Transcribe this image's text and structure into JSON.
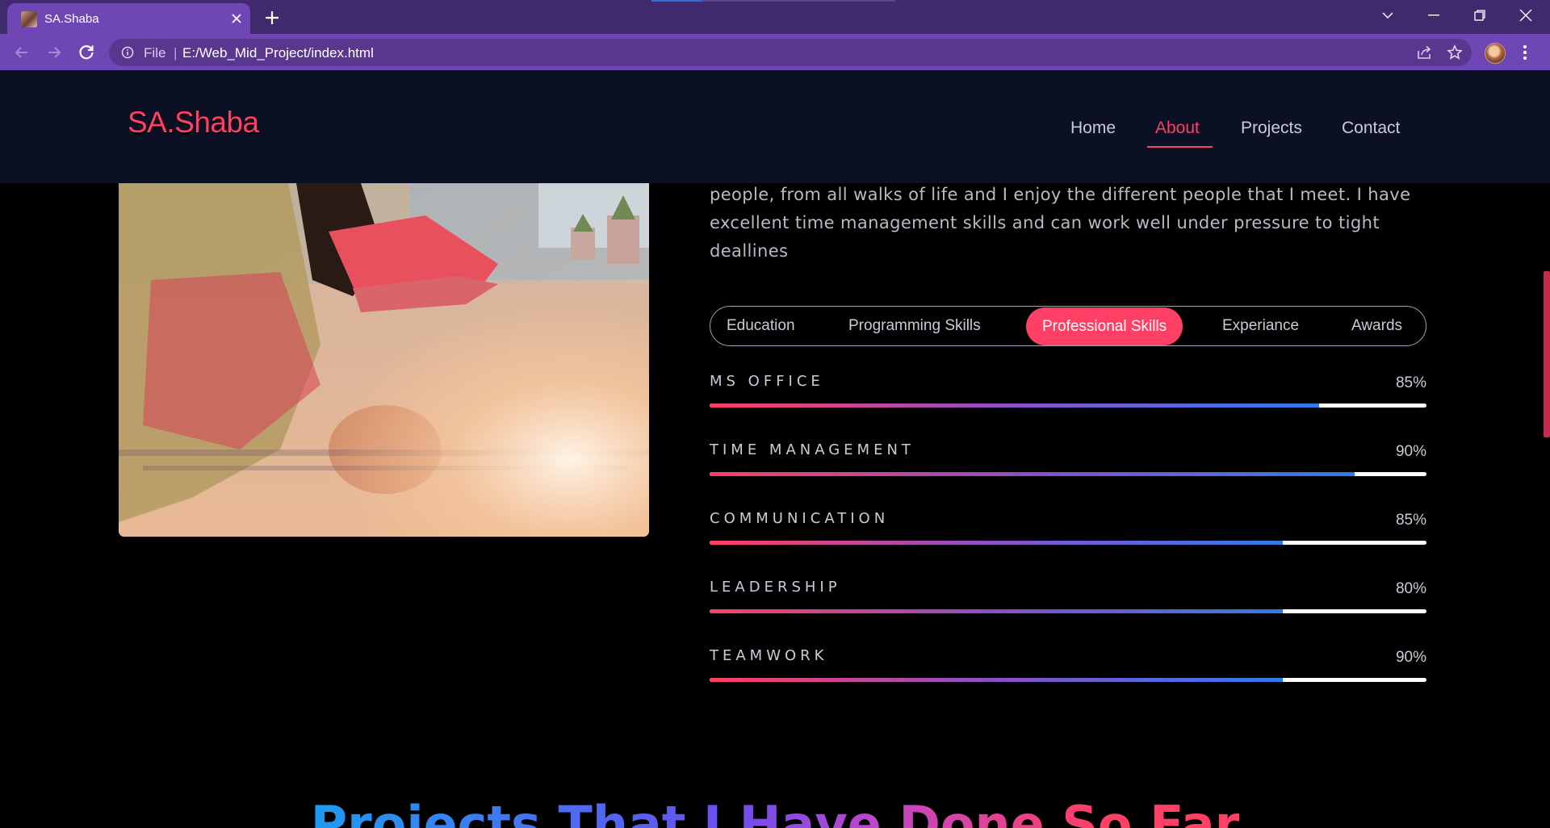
{
  "browser": {
    "tab_title": "SA.Shaba",
    "omnibox_scheme": "File",
    "omnibox_url": "E:/Web_Mid_Project/index.html"
  },
  "site": {
    "logo": "SA.Shaba",
    "nav": [
      {
        "label": "Home"
      },
      {
        "label": "About"
      },
      {
        "label": "Projects"
      },
      {
        "label": "Contact"
      }
    ],
    "active_nav": "About",
    "accent_color": "#ff3f63"
  },
  "about": {
    "text_lines": [
      "people, from all walks of life and I enjoy the different people that I meet. I have",
      "excellent time management skills and can work well under pressure to tight",
      "deallines"
    ]
  },
  "tabs": [
    {
      "label": "Education"
    },
    {
      "label": "Programming Skills"
    },
    {
      "label": "Professional Skills"
    },
    {
      "label": "Experiance"
    },
    {
      "label": "Awards"
    }
  ],
  "active_tab": "Professional Skills",
  "skills": [
    {
      "name": "MS OFFICE",
      "percent_label": "85%",
      "bar_fill": 0.85
    },
    {
      "name": "TIME MANAGEMENT",
      "percent_label": "90%",
      "bar_fill": 0.9
    },
    {
      "name": "COMMUNICATION",
      "percent_label": "85%",
      "bar_fill": 0.8
    },
    {
      "name": "LEADERSHIP",
      "percent_label": "80%",
      "bar_fill": 0.8
    },
    {
      "name": "TEAMWORK",
      "percent_label": "90%",
      "bar_fill": 0.8
    }
  ],
  "projects": {
    "heading": "Projects That I Have Done So Far"
  }
}
